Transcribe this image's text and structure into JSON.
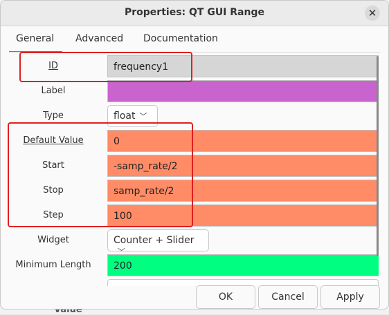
{
  "dialog": {
    "title": "Properties: QT GUI Range",
    "close_icon": "close-icon"
  },
  "tabs": [
    {
      "label": "General",
      "active": true
    },
    {
      "label": "Advanced",
      "active": false
    },
    {
      "label": "Documentation",
      "active": false
    }
  ],
  "fields": {
    "id": {
      "label": "ID",
      "value": "frequency1"
    },
    "label": {
      "label": "Label",
      "value": ""
    },
    "type": {
      "label": "Type",
      "value": "float"
    },
    "default_value": {
      "label": "Default Value",
      "value": "0"
    },
    "start": {
      "label": "Start",
      "value": "-samp_rate/2"
    },
    "stop": {
      "label": "Stop",
      "value": "samp_rate/2"
    },
    "step": {
      "label": "Step",
      "value": "100"
    },
    "widget": {
      "label": "Widget",
      "value": "Counter + Slider"
    },
    "minimum_length": {
      "label": "Minimum Length",
      "value": "200"
    }
  },
  "buttons": {
    "ok": "OK",
    "cancel": "Cancel",
    "apply": "Apply"
  },
  "background_text": "Value",
  "colors": {
    "id_field": "#d6d6d6",
    "label_field": "#c964cf",
    "numeric_fields": "#ff8c66",
    "minimum_length_field": "#00ff80",
    "highlight": "#e0201f",
    "accent": "#e95420"
  }
}
